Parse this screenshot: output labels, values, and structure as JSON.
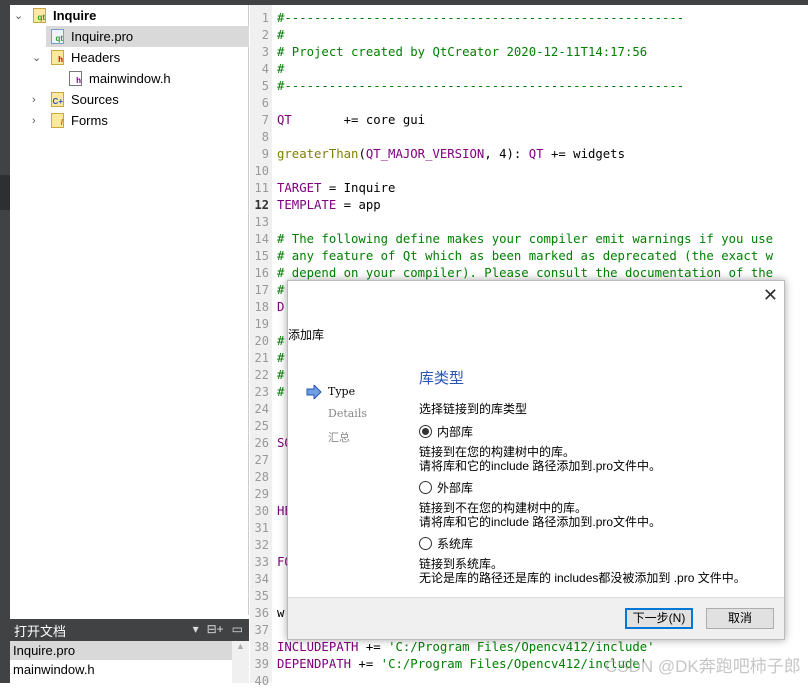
{
  "project_tree": {
    "root": "Inquire",
    "items": [
      {
        "label": "Inquire.pro",
        "icon": "qt-pro-file-icon"
      },
      {
        "label": "Headers",
        "icon": "headers-folder-icon"
      },
      {
        "label": "mainwindow.h",
        "icon": "header-file-icon"
      },
      {
        "label": "Sources",
        "icon": "sources-folder-icon"
      },
      {
        "label": "Forms",
        "icon": "forms-folder-icon"
      }
    ]
  },
  "open_documents": {
    "title": "打开文档",
    "items": [
      "Inquire.pro",
      "mainwindow.h"
    ]
  },
  "editor": {
    "current_line": 12,
    "lines": [
      "#------------------------------------------------------",
      "#",
      "# Project created by QtCreator 2020-12-11T14:17:56",
      "#",
      "#------------------------------------------------------",
      "",
      "QT       += core gui",
      "",
      "greaterThan(QT_MAJOR_VERSION, 4): QT += widgets",
      "",
      "TARGET = Inquire",
      "TEMPLATE = app",
      "",
      "# The following define makes your compiler emit warnings if you use",
      "# any feature of Qt which as been marked as deprecated (the exact w",
      "# depend on your compiler). Please consult the documentation of the",
      "#                                                                m t",
      "D",
      "",
      "#                                                                ted",
      "#",
      "#                                                                rta",
      "#                                                                all",
      "",
      "",
      "SO",
      "",
      "",
      "",
      "HE",
      "",
      "",
      "FO",
      "",
      "",
      "w                                                                end",
      "",
      "INCLUDEPATH += 'C:/Program Files/Opencv412/include'",
      "DEPENDPATH += 'C:/Program Files/Opencv412/include'",
      ""
    ]
  },
  "dialog": {
    "title": "添加库",
    "steps": [
      "Type",
      "Details",
      "汇总"
    ],
    "page_title": "库类型",
    "prompt": "选择链接到的库类型",
    "options": [
      {
        "label": "内部库",
        "selected": true,
        "desc1": "链接到在您的构建树中的库。",
        "desc2": "请将库和它的include 路径添加到.pro文件中。"
      },
      {
        "label": "外部库",
        "selected": false,
        "desc1": "链接到不在您的构建树中的库。",
        "desc2": "请将库和它的include 路径添加到.pro文件中。"
      },
      {
        "label": "系统库",
        "selected": false,
        "desc1": "链接到系统库。",
        "desc2": "无论是库的路径还是库的 includes都没被添加到 .pro 文件中。"
      }
    ],
    "next_button": "下一步(N)",
    "cancel_button": "取消"
  },
  "watermark": "CSDN @DK奔跑吧柿子郎",
  "colors": {
    "comment": "#008000",
    "keyword": "#800080",
    "function": "#808000",
    "accent": "#2a55b5",
    "default_button": "#0078d7"
  }
}
